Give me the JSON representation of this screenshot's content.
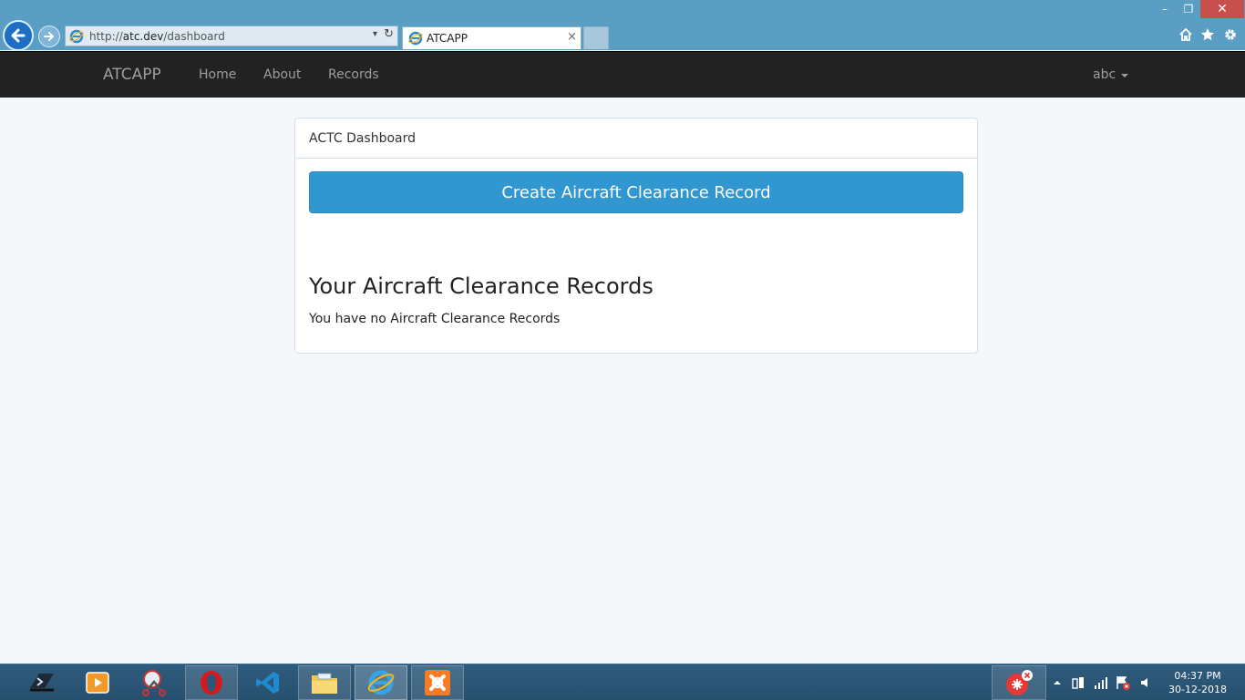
{
  "browser": {
    "url_prefix": "http://",
    "url_domain": "atc.dev",
    "url_path": "/dashboard",
    "tab_title": "ATCAPP",
    "tab_close": "×",
    "dropdown_glyph": "▾",
    "refresh_glyph": "↻",
    "window_minimize": "–",
    "window_restore": "❐",
    "window_close": "✕",
    "toolbar_icons": [
      "home-icon",
      "favorites-star-icon",
      "settings-gear-icon"
    ]
  },
  "navbar": {
    "brand": "ATCAPP",
    "links": [
      {
        "label": "Home"
      },
      {
        "label": "About"
      },
      {
        "label": "Records"
      }
    ],
    "user": "abc"
  },
  "panel": {
    "heading": "ACTC Dashboard",
    "create_button": "Create Aircraft Clearance Record",
    "records_heading": "Your Aircraft Clearance Records",
    "empty_message": "You have no Aircraft Clearance Records"
  },
  "taskbar": {
    "apps": [
      "terminal-app-icon",
      "media-player-icon",
      "snipping-tool-icon",
      "opera-browser-icon",
      "vscode-icon",
      "file-explorer-icon",
      "internet-explorer-icon",
      "xampp-icon"
    ],
    "clock_time": "04:37 PM",
    "clock_date": "30-12-2018"
  },
  "colors": {
    "chrome": "#5b9ec3",
    "navbar": "#222222",
    "primary_button": "#3097d1",
    "page_bg": "#f4f8fb",
    "close_button": "#c7504c"
  }
}
